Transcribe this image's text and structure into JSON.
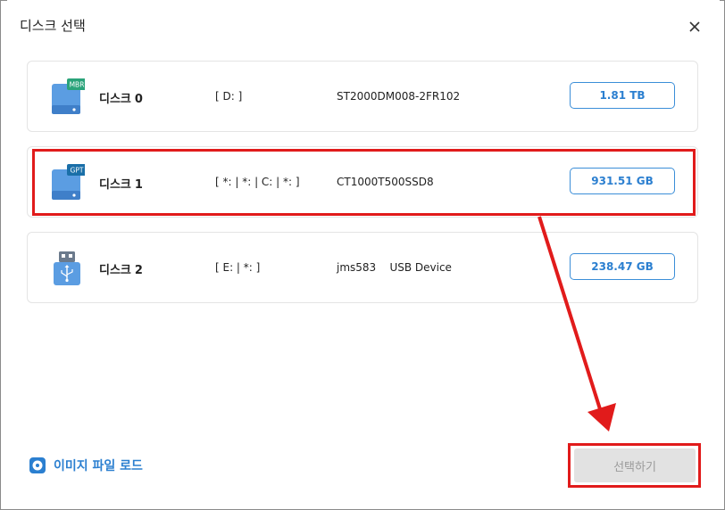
{
  "dialog": {
    "title": "디스크 선택"
  },
  "disks": [
    {
      "name": "디스크",
      "index": "0",
      "badge": "MBR",
      "badge_color": "#2aa37a",
      "partitions": "[ D: ]",
      "model": "ST2000DM008-2FR102",
      "size": "1.81 TB",
      "icon": "hard-disk-icon"
    },
    {
      "name": "디스크",
      "index": "1",
      "badge": "GPT",
      "badge_color": "#1a6fa8",
      "partitions": "[ *: | *: | C: | *: ]",
      "model": "CT1000T500SSD8",
      "size": "931.51 GB",
      "icon": "hard-disk-icon"
    },
    {
      "name": "디스크",
      "index": "2",
      "partitions": "[ E: | *: ]",
      "model": "jms583    USB Device",
      "size": "238.47 GB",
      "icon": "usb-drive-icon"
    }
  ],
  "footer": {
    "load_image_label": "이미지 파일 로드",
    "select_label": "선택하기"
  },
  "colors": {
    "accent": "#2b7fd0",
    "annotation_red": "#e11b1b",
    "disk_icon_blue": "#5b9de2"
  }
}
